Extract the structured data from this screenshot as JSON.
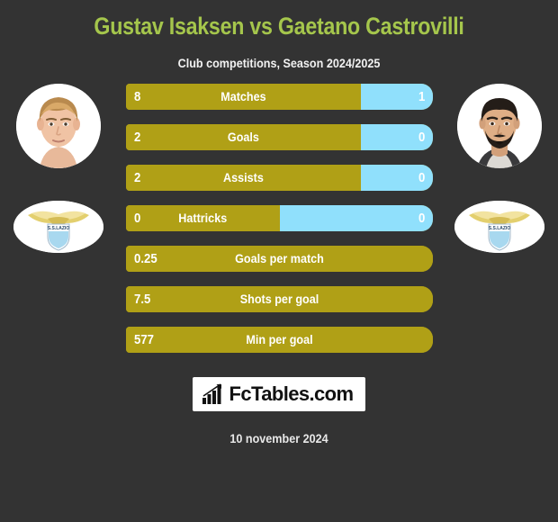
{
  "page": {
    "background_color": "#333333",
    "title": "Gustav Isaksen vs Gaetano Castrovilli",
    "title_color": "#a5c64c",
    "subtitle": "Club competitions, Season 2024/2025",
    "date": "10 november 2024"
  },
  "colors": {
    "bar_left": "#b0a016",
    "bar_right": "#90e0fc",
    "title_green": "#a5c64c",
    "text_white": "#ffffff",
    "background": "#333333",
    "logo_background": "#ffffff",
    "logo_text": "#111111"
  },
  "players": {
    "left": {
      "name": "Gustav Isaksen",
      "photo_alt": "player-photo-gustav-isaksen",
      "club": "S.S. Lazio",
      "crest_alt": "ss-lazio-crest"
    },
    "right": {
      "name": "Gaetano Castrovilli",
      "photo_alt": "player-photo-gaetano-castrovilli",
      "club": "S.S. Lazio",
      "crest_alt": "ss-lazio-crest"
    }
  },
  "chart_data": {
    "type": "bar",
    "title": "Gustav Isaksen vs Gaetano Castrovilli",
    "subtitle": "Club competitions, Season 2024/2025",
    "orientation": "horizontal-diverging",
    "series": [
      {
        "name": "Gustav Isaksen",
        "color": "#b0a016"
      },
      {
        "name": "Gaetano Castrovilli",
        "color": "#90e0fc"
      }
    ],
    "categories": [
      "Matches",
      "Goals",
      "Assists",
      "Hattricks",
      "Goals per match",
      "Shots per goal",
      "Min per goal"
    ],
    "rows": [
      {
        "label": "Matches",
        "left_value": "8",
        "right_value": "1",
        "left_pct": 76.5,
        "right_pct": 23.5,
        "split": true
      },
      {
        "label": "Goals",
        "left_value": "2",
        "right_value": "0",
        "left_pct": 76.5,
        "right_pct": 23.5,
        "split": true
      },
      {
        "label": "Assists",
        "left_value": "2",
        "right_value": "0",
        "left_pct": 76.5,
        "right_pct": 23.5,
        "split": true
      },
      {
        "label": "Hattricks",
        "left_value": "0",
        "right_value": "0",
        "left_pct": 50.0,
        "right_pct": 50.0,
        "split": true
      },
      {
        "label": "Goals per match",
        "left_value": "0.25",
        "right_value": "",
        "left_pct": 100,
        "right_pct": 0,
        "split": false
      },
      {
        "label": "Shots per goal",
        "left_value": "7.5",
        "right_value": "",
        "left_pct": 100,
        "right_pct": 0,
        "split": false
      },
      {
        "label": "Min per goal",
        "left_value": "577",
        "right_value": "",
        "left_pct": 100,
        "right_pct": 0,
        "split": false
      }
    ]
  },
  "footer": {
    "logo_text": "FcTables.com",
    "logo_icon": "bar-chart-growth-icon",
    "date": "10 november 2024"
  }
}
